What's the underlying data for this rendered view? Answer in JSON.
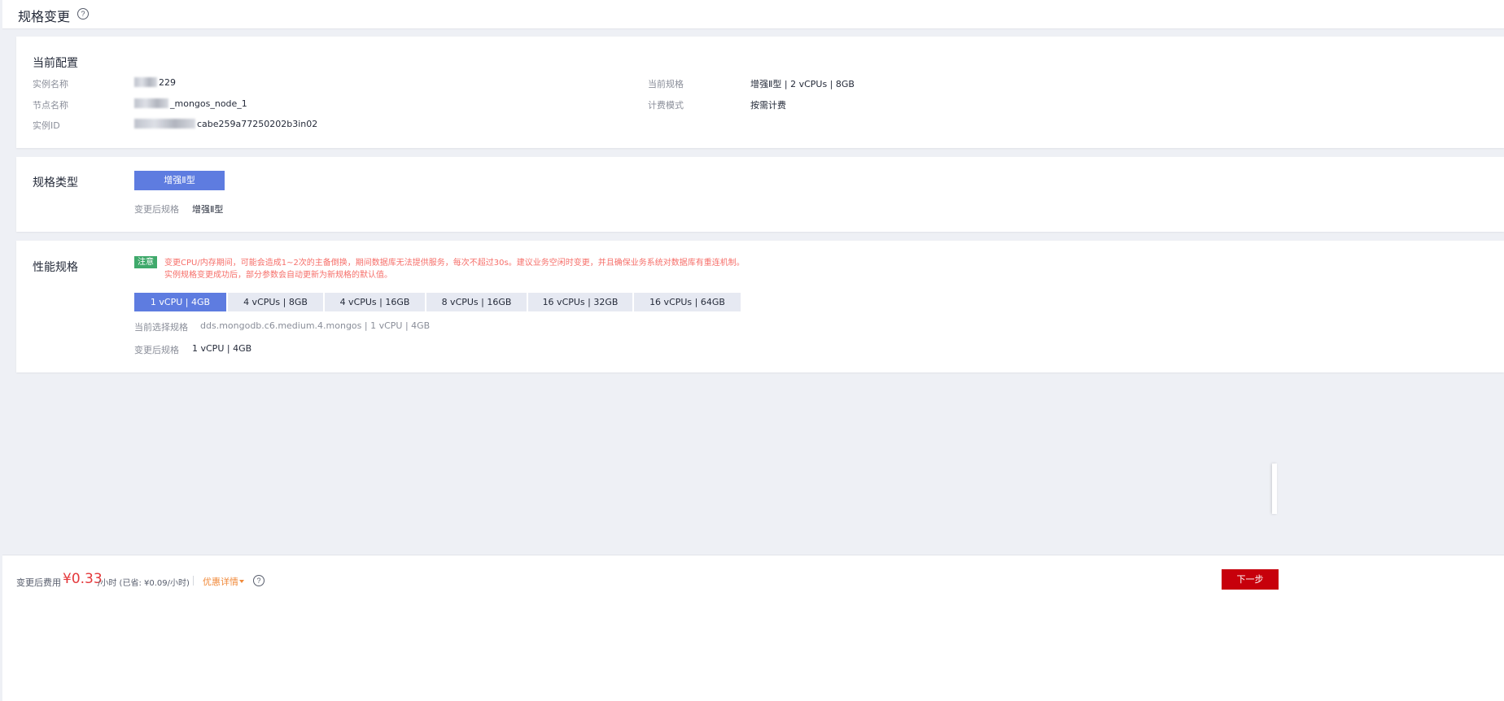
{
  "header": {
    "title": "规格变更",
    "help_icon": "?"
  },
  "current_config": {
    "title": "当前配置",
    "instance_name_label": "实例名称",
    "instance_name_value": "229",
    "node_name_label": "节点名称",
    "node_name_value": "_mongos_node_1",
    "instance_id_label": "实例ID",
    "instance_id_value": "cabe259a77250202b3in02",
    "current_spec_label": "当前规格",
    "current_spec_value": "增强Ⅱ型 | 2 vCPUs | 8GB",
    "billing_mode_label": "计费模式",
    "billing_mode_value": "按需计费"
  },
  "spec_type": {
    "title": "规格类型",
    "option_label": "增强Ⅱ型",
    "after_label": "变更后规格",
    "after_value": "增强Ⅱ型"
  },
  "performance": {
    "title": "性能规格",
    "notice_badge": "注意",
    "notice_line1": "变更CPU/内存期间，可能会造成1~2次的主备倒换，期间数据库无法提供服务，每次不超过30s。建议业务空闲时变更，并且确保业务系统对数据库有重连机制。",
    "notice_line2": "实例规格变更成功后，部分参数会自动更新为新规格的默认值。",
    "options": [
      "1 vCPU | 4GB",
      "4 vCPUs | 8GB",
      "4 vCPUs | 16GB",
      "8 vCPUs | 16GB",
      "16 vCPUs | 32GB",
      "16 vCPUs | 64GB"
    ],
    "selected_index": 0,
    "current_selected_label": "当前选择规格",
    "current_selected_value": "dds.mongodb.c6.medium.4.mongos | 1 vCPU | 4GB",
    "after_label": "变更后规格",
    "after_value": "1 vCPU | 4GB"
  },
  "footer": {
    "fee_label": "变更后费用",
    "price": "¥0.33",
    "unit": "/小时 (已省: ¥0.09/小时)",
    "discount_link": "优惠详情",
    "help_icon": "?",
    "next_button": "下一步"
  },
  "colors": {
    "primary": "#5e7ce0",
    "danger_button": "#c7000b",
    "price": "#e4383b",
    "notice_text": "#f66f6a",
    "notice_badge": "#3fa96b",
    "link_orange": "#f08a3b"
  }
}
